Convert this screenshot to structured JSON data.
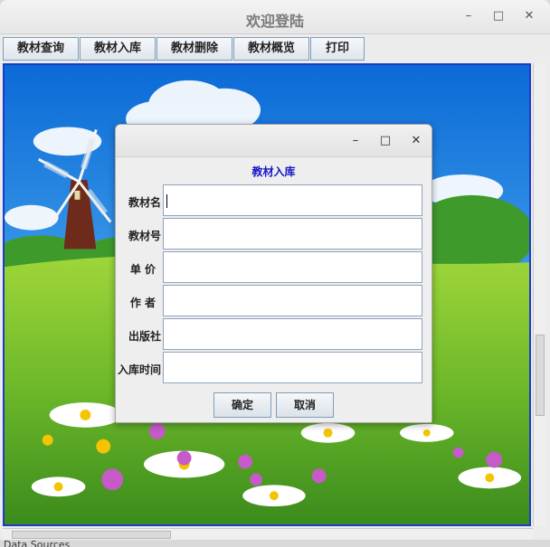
{
  "window": {
    "title": "欢迎登陆",
    "minimize": "–",
    "maximize": "□",
    "close": "✕"
  },
  "menu": [
    "教材查询",
    "教材入库",
    "教材删除",
    "教材概览",
    "打印"
  ],
  "dialog": {
    "heading": "教材入库",
    "minimize": "–",
    "maximize": "□",
    "close": "✕",
    "fields": [
      {
        "label": "教材名",
        "value": ""
      },
      {
        "label": "教材号",
        "value": ""
      },
      {
        "label": "单 价",
        "value": ""
      },
      {
        "label": "作 者",
        "value": ""
      },
      {
        "label": "出版社",
        "value": ""
      },
      {
        "label": "入库时间",
        "value": ""
      }
    ],
    "confirm_label": "确定",
    "cancel_label": "取消"
  },
  "status_text": "Data Sources",
  "colors": {
    "dialog_heading": "#1515c8",
    "desktop_border": "#1a3cc9"
  }
}
